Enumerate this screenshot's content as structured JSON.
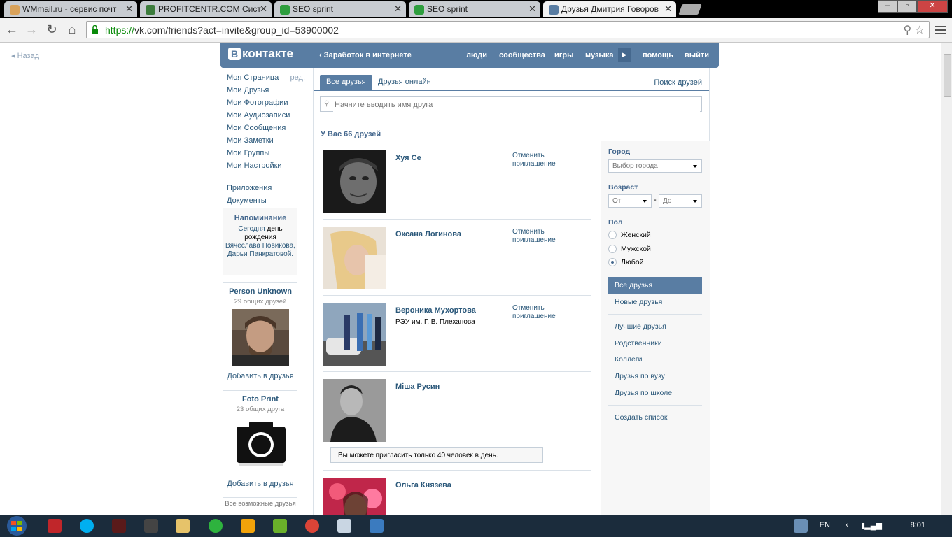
{
  "browser": {
    "tabs": [
      {
        "title": "WMmail.ru - сервис почт",
        "icon": "wmmail-icon",
        "color": "#d9a25a"
      },
      {
        "title": "PROFITCENTR.COM Сист",
        "icon": "chart-icon",
        "color": "#3c7c3c"
      },
      {
        "title": "SEO sprint",
        "icon": "seosprint-icon",
        "color": "#2e9e3e"
      },
      {
        "title": "SEO sprint",
        "icon": "seosprint-icon",
        "color": "#2e9e3e"
      },
      {
        "title": "Друзья Дмитрия Говоров",
        "icon": "vk-icon",
        "color": "#597da3"
      }
    ],
    "url_scheme": "https://",
    "url_rest": "vk.com/friends?act=invite&group_id=53900002"
  },
  "page": {
    "back_label": "Назад",
    "header": {
      "logo_text": "контакте",
      "logo_letter": "В",
      "breadcrumb": "Заработок в интернете",
      "nav": [
        "люди",
        "сообщества",
        "игры",
        "музыка",
        "помощь",
        "выйти"
      ]
    },
    "left_nav": {
      "items": [
        "Моя Страница",
        "Мои Друзья",
        "Мои Фотографии",
        "Мои Аудиозаписи",
        "Мои Сообщения",
        "Мои Заметки",
        "Мои Группы",
        "Мои Настройки"
      ],
      "edit_label": "ред.",
      "extra": [
        "Приложения",
        "Документы"
      ]
    },
    "reminder": {
      "title": "Напоминание",
      "today": "Сегодня",
      "text1": "день рождения",
      "names": "Вячеслава Новикова, Дарьи Панкратовой."
    },
    "suggestions": [
      {
        "name": "Person Unknown",
        "common": "29 общих друзей",
        "add": "Добавить в друзья"
      },
      {
        "name": "Foto Print",
        "common": "23 общих друга",
        "add": "Добавить в друзья"
      }
    ],
    "all_possible": "Все возможные друзья",
    "tabs": {
      "all": "Все друзья",
      "online": "Друзья онлайн",
      "find": "Поиск друзей"
    },
    "search_placeholder": "Начните вводить имя друга",
    "count_label": "У Вас 66 друзей",
    "friends": [
      {
        "name": "Хуя Се",
        "sub": "",
        "action": "Отменить приглашение"
      },
      {
        "name": "Оксана Логинова",
        "sub": "",
        "action": "Отменить приглашение"
      },
      {
        "name": "Вероника Мухортова",
        "sub": "РЭУ им. Г. В. Плеханова",
        "action": "Отменить приглашение"
      },
      {
        "name": "Міша Русин",
        "sub": "",
        "action": ""
      },
      {
        "name": "Ольга Князева",
        "sub": "",
        "action": ""
      }
    ],
    "limit_notice": "Вы можете пригласить только 40 человек в день.",
    "filters": {
      "city_label": "Город",
      "city_select": "Выбор города",
      "age_label": "Возраст",
      "age_from": "От",
      "age_dash": "-",
      "age_to": "До",
      "gender_label": "Пол",
      "gender_options": [
        "Женский",
        "Мужской",
        "Любой"
      ],
      "gender_selected": "Любой",
      "lists": [
        "Все друзья",
        "Новые друзья"
      ],
      "lists2": [
        "Лучшие друзья",
        "Родственники",
        "Коллеги",
        "Друзья по вузу",
        "Друзья по школе"
      ],
      "create": "Создать список"
    }
  },
  "taskbar": {
    "lang": "EN",
    "time": "8:01"
  },
  "colors": {
    "vk_blue": "#597da3",
    "vk_link": "#2b587a",
    "https_green": "#0a8a0a"
  }
}
